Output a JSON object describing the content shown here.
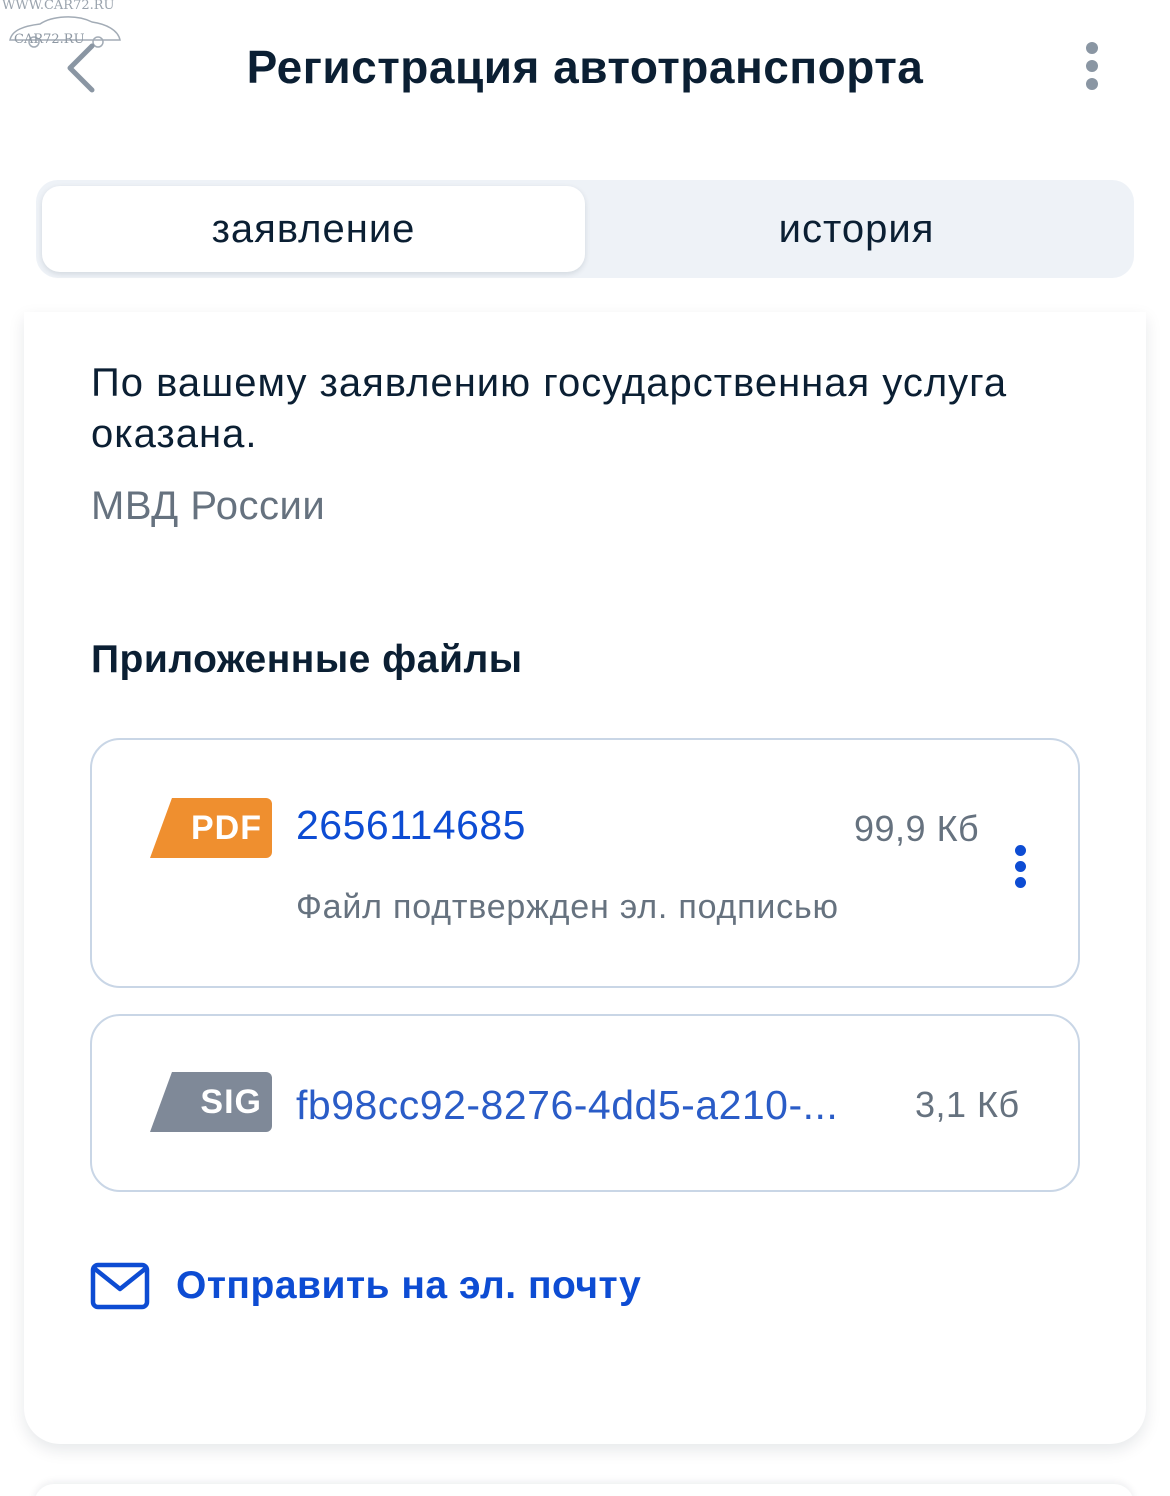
{
  "watermark": {
    "top_text": "WWW.CAR72.RU",
    "logo_text": "CAR72.RU"
  },
  "header": {
    "title": "Регистрация автотранспорта",
    "back_icon": "chevron-left-icon",
    "menu_icon": "more-vertical-icon"
  },
  "tabs": [
    {
      "label": "заявление",
      "active": true
    },
    {
      "label": "история",
      "active": false
    }
  ],
  "status": {
    "message": "По вашему заявлению государственная услуга оказана.",
    "organization": "МВД России"
  },
  "attachments": {
    "title": "Приложенные файлы",
    "files": [
      {
        "type": "PDF",
        "name": "2656114685",
        "size": "99,9 Кб",
        "note": "Файл подтвержден эл. подписью",
        "badge_color": "#ef8f2f"
      },
      {
        "type": "SIG",
        "name": "fb98cc92-8276-4dd5-a210-...",
        "size": "3,1 Кб",
        "badge_color": "#7f8998"
      }
    ]
  },
  "actions": {
    "send_email_label": "Отправить на эл. почту",
    "email_icon": "envelope-icon"
  },
  "colors": {
    "accent": "#0d4cd3",
    "text_primary": "#0b1f33",
    "text_secondary": "#66727f",
    "tab_background": "#eef2f7"
  }
}
